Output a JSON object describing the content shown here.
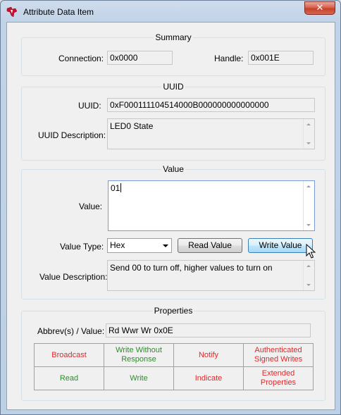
{
  "window": {
    "title": "Attribute Data Item",
    "close_glyph": "✕",
    "icon": "texas-instruments-logo-icon"
  },
  "summary": {
    "title": "Summary",
    "connection_label": "Connection:",
    "connection_value": "0x0000",
    "handle_label": "Handle:",
    "handle_value": "0x001E"
  },
  "uuid": {
    "title": "UUID",
    "uuid_label": "UUID:",
    "uuid_value": "0xF000111104514000B000000000000000",
    "description_label": "UUID Description:",
    "description_value": "LED0 State"
  },
  "value": {
    "title": "Value",
    "value_label": "Value:",
    "value_text": "01",
    "type_label": "Value Type:",
    "type_selected": "Hex",
    "read_button": "Read Value",
    "write_button": "Write Value",
    "description_label": "Value Description:",
    "description_value": "Send 00 to turn off, higher values to turn on"
  },
  "properties": {
    "title": "Properties",
    "abbrev_label": "Abbrev(s) / Value:",
    "abbrev_value": "Rd Wwr Wr  0x0E",
    "flags": [
      [
        "Broadcast",
        "Write Without Response",
        "Notify",
        "Authenticated Signed Writes"
      ],
      [
        "Read",
        "Write",
        "Indicate",
        "Extended Properties"
      ]
    ],
    "colors": {
      "enabled": "#2e8b2e",
      "disabled": "#e0282a"
    }
  }
}
